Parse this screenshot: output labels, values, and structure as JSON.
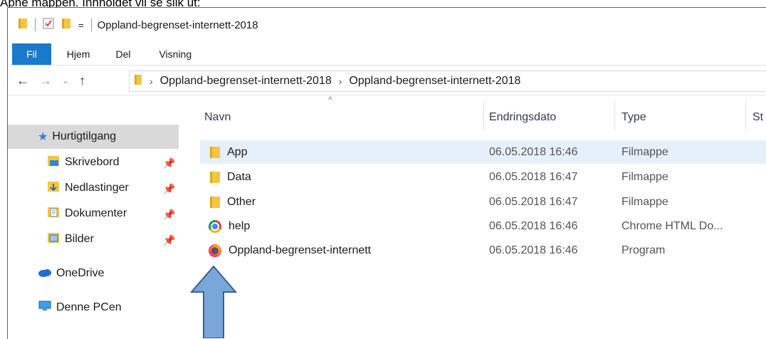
{
  "caption": "Apne mappen. Innholdet vil se slik ut:",
  "window": {
    "title": "Oppland-begrenset-internett-2018",
    "quick_access_dropdown": "="
  },
  "ribbon": {
    "tabs": [
      {
        "label": "Fil"
      },
      {
        "label": "Hjem"
      },
      {
        "label": "Del"
      },
      {
        "label": "Visning"
      }
    ]
  },
  "address": {
    "breadcrumb": [
      "Oppland-begrenset-internett-2018",
      "Oppland-begrenset-internett-2018"
    ]
  },
  "sidebar": {
    "items": [
      {
        "label": "Hurtigtilgang"
      },
      {
        "label": "Skrivebord"
      },
      {
        "label": "Nedlastinger"
      },
      {
        "label": "Dokumenter"
      },
      {
        "label": "Bilder"
      },
      {
        "label": "OneDrive"
      },
      {
        "label": "Denne PCen"
      }
    ]
  },
  "columns": {
    "name": "Navn",
    "modified": "Endringsdato",
    "type": "Type",
    "size": "St"
  },
  "files": [
    {
      "name": "App",
      "modified": "06.05.2018 16:46",
      "type": "Filmappe",
      "icon": "folder-icon"
    },
    {
      "name": "Data",
      "modified": "06.05.2018 16:47",
      "type": "Filmappe",
      "icon": "folder-icon"
    },
    {
      "name": "Other",
      "modified": "06.05.2018 16:47",
      "type": "Filmappe",
      "icon": "folder-icon"
    },
    {
      "name": "help",
      "modified": "06.05.2018 16:46",
      "type": "Chrome HTML Do...",
      "icon": "chrome-icon"
    },
    {
      "name": "Oppland-begrenset-internett",
      "modified": "06.05.2018 16:46",
      "type": "Program",
      "icon": "firefox-icon"
    }
  ],
  "colors": {
    "accent": "#1979ca",
    "selection": "#e5f0fb",
    "arrow_fill": "#7aa7d9",
    "arrow_stroke": "#3b5f92"
  }
}
